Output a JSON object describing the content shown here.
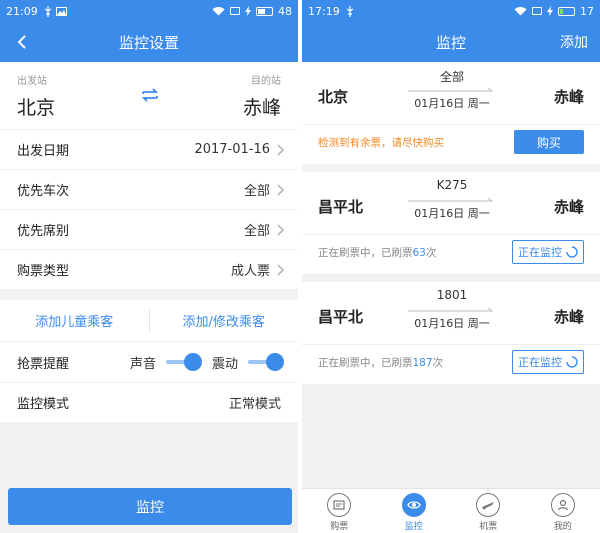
{
  "left": {
    "status_bar": {
      "time": "21:09",
      "battery": "48"
    },
    "nav": {
      "title": "监控设置"
    },
    "route": {
      "from_label": "出发站",
      "from_city": "北京",
      "to_label": "目的站",
      "to_city": "赤峰"
    },
    "rows": [
      {
        "label": "出发日期",
        "value": "2017-01-16"
      },
      {
        "label": "优先车次",
        "value": "全部"
      },
      {
        "label": "优先席别",
        "value": "全部"
      },
      {
        "label": "购票类型",
        "value": "成人票"
      }
    ],
    "passengers": {
      "add_child": "添加儿童乘客",
      "add_edit": "添加/修改乘客"
    },
    "alert_row": {
      "label": "抢票提醒",
      "sound": "声音",
      "vibrate": "震动",
      "sound_on": true,
      "vibrate_on": true
    },
    "mode_row": {
      "label": "监控模式",
      "value": "正常模式"
    },
    "monitor_button": "监控"
  },
  "right": {
    "status_bar": {
      "time": "17:19",
      "battery": "17"
    },
    "nav": {
      "title": "监控",
      "add": "添加"
    },
    "cards": [
      {
        "from": "北京",
        "to": "赤峰",
        "train": "全部",
        "date": "01月16日 周一",
        "status": "检测到有余票，请尽快购买",
        "action": "购买"
      },
      {
        "from": "昌平北",
        "to": "赤峰",
        "train": "K275",
        "date": "01月16日 周一",
        "status_prefix": "正在刷票中，已刷票",
        "count": "63",
        "status_suffix": "次",
        "action": "正在监控"
      },
      {
        "from": "昌平北",
        "to": "赤峰",
        "train": "1801",
        "date": "01月16日 周一",
        "status_prefix": "正在刷票中，已刷票",
        "count": "187",
        "status_suffix": "次",
        "action": "正在监控"
      }
    ],
    "tabs": [
      {
        "label": "购票",
        "icon": "ticket-icon"
      },
      {
        "label": "监控",
        "icon": "eye-icon",
        "active": true
      },
      {
        "label": "机票",
        "icon": "plane-icon"
      },
      {
        "label": "我的",
        "icon": "user-icon"
      }
    ]
  },
  "colors": {
    "primary": "#3b8beb",
    "alert": "#f08a24",
    "background": "#f2f2f2"
  }
}
